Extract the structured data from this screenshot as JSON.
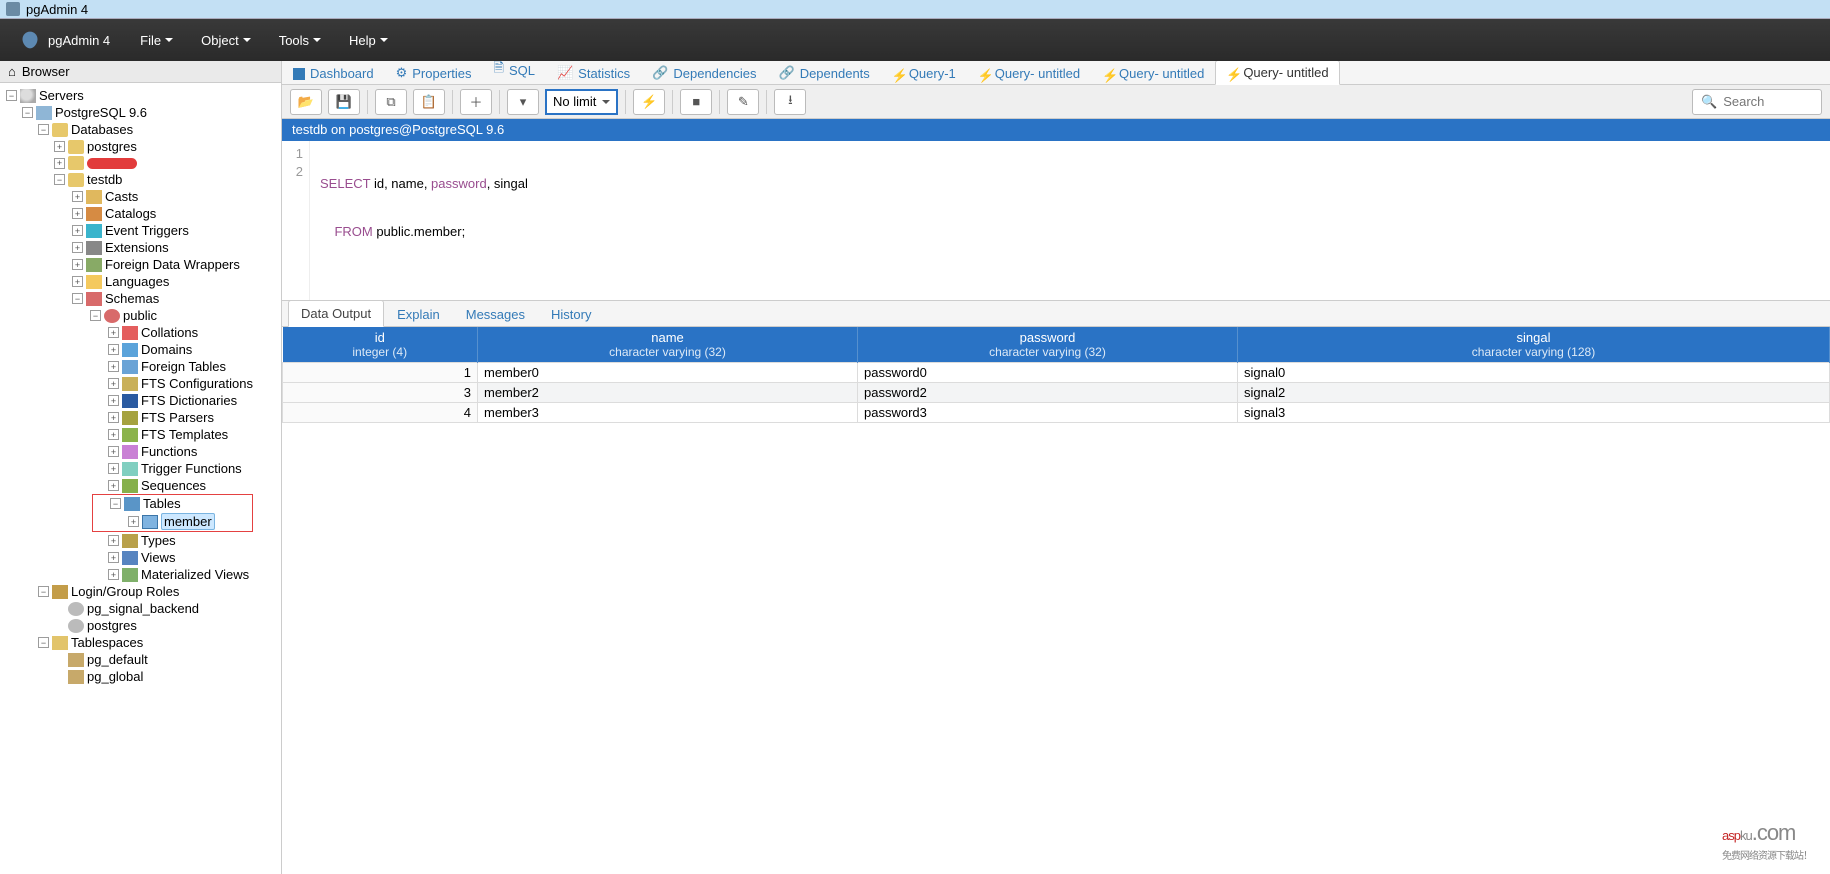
{
  "window": {
    "title": "pgAdmin 4"
  },
  "brand": "pgAdmin 4",
  "menu": {
    "file": "File",
    "object": "Object",
    "tools": "Tools",
    "help": "Help"
  },
  "browser": {
    "title": "Browser",
    "servers": "Servers",
    "server": "PostgreSQL 9.6",
    "databases": "Databases",
    "db_postgres": "postgres",
    "db_testdb": "testdb",
    "casts": "Casts",
    "catalogs": "Catalogs",
    "event_triggers": "Event Triggers",
    "extensions": "Extensions",
    "fdw": "Foreign Data Wrappers",
    "languages": "Languages",
    "schemas": "Schemas",
    "public": "public",
    "collations": "Collations",
    "domains": "Domains",
    "foreign_tables": "Foreign Tables",
    "fts_conf": "FTS Configurations",
    "fts_dict": "FTS Dictionaries",
    "fts_pars": "FTS Parsers",
    "fts_tmpl": "FTS Templates",
    "functions": "Functions",
    "trigger_functions": "Trigger Functions",
    "sequences": "Sequences",
    "tables": "Tables",
    "member": "member",
    "types": "Types",
    "views": "Views",
    "mat_views": "Materialized Views",
    "login_roles": "Login/Group Roles",
    "pg_signal_backend": "pg_signal_backend",
    "role_postgres": "postgres",
    "tablespaces": "Tablespaces",
    "pg_default": "pg_default",
    "pg_global": "pg_global"
  },
  "tabs": {
    "dashboard": "Dashboard",
    "properties": "Properties",
    "sql": "SQL",
    "statistics": "Statistics",
    "dependencies": "Dependencies",
    "dependents": "Dependents",
    "q1": "Query-1",
    "q2": "Query- untitled",
    "q3": "Query- untitled",
    "q4": "Query- untitled"
  },
  "toolbar": {
    "limit": "No limit"
  },
  "search": {
    "placeholder": "Search"
  },
  "conn": "testdb on postgres@PostgreSQL 9.6",
  "sql": {
    "line1_a": "SELECT",
    "line1_b": " id, name, ",
    "line1_c": "password",
    "line1_d": ", singal",
    "line2_a": "    FROM",
    "line2_b": " public.member;"
  },
  "result_tabs": {
    "data": "Data Output",
    "explain": "Explain",
    "messages": "Messages",
    "history": "History"
  },
  "columns": [
    {
      "name": "id",
      "type": "integer (4)"
    },
    {
      "name": "name",
      "type": "character varying (32)"
    },
    {
      "name": "password",
      "type": "character varying (32)"
    },
    {
      "name": "singal",
      "type": "character varying (128)"
    }
  ],
  "rows": [
    {
      "id": "1",
      "name": "member0",
      "password": "password0",
      "singal": "signal0"
    },
    {
      "id": "3",
      "name": "member2",
      "password": "password2",
      "singal": "signal2"
    },
    {
      "id": "4",
      "name": "member3",
      "password": "password3",
      "singal": "signal3"
    }
  ],
  "watermark": {
    "a": "asp",
    "b": "ku",
    "c": ".com",
    "sub": "免费网络资源下载站！"
  }
}
